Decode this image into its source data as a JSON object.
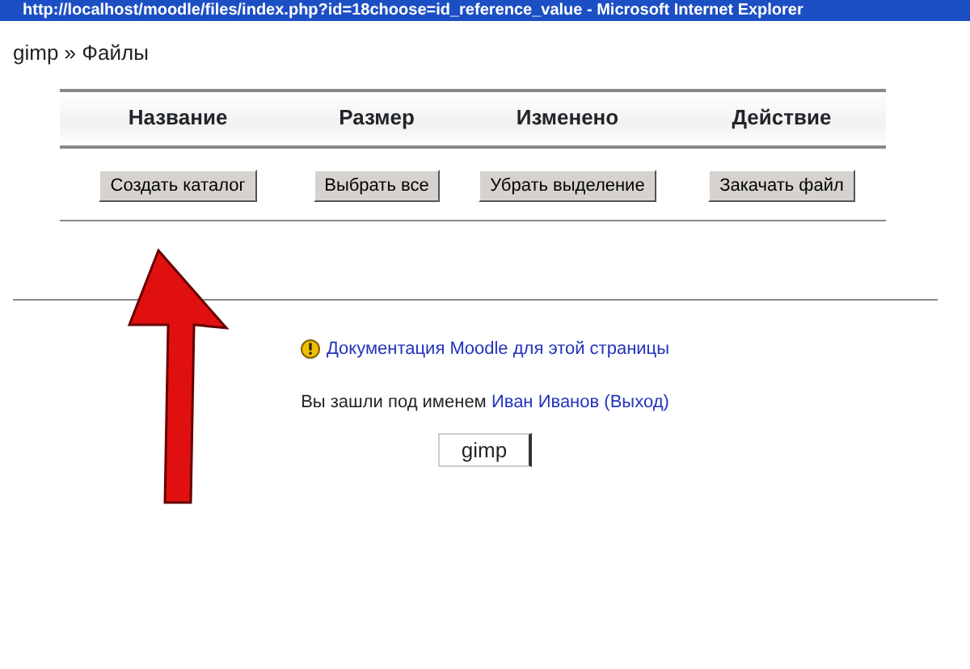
{
  "window": {
    "title": "http://localhost/moodle/files/index.php?id=18choose=id_reference_value - Microsoft Internet Explorer"
  },
  "breadcrumb": "gimp » Файлы",
  "table": {
    "columns": [
      "Название",
      "Размер",
      "Изменено",
      "Действие"
    ]
  },
  "buttons": [
    "Создать каталог",
    "Выбрать все",
    "Убрать выделение",
    "Закачать файл"
  ],
  "doc_link": "Документация Moodle для этой страницы",
  "login": {
    "prefix": "Вы зашли под именем",
    "user": "Иван Иванов",
    "open": "(",
    "logout": "Выход",
    "close": ")"
  },
  "course_field": "gimp"
}
